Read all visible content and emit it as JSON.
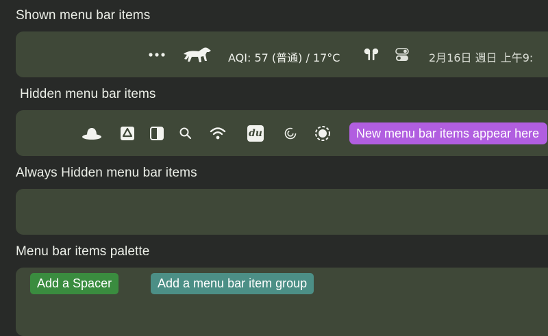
{
  "sections": {
    "shown_title": "Shown menu bar items",
    "hidden_title": "Hidden menu bar items",
    "always_hidden_title": "Always Hidden menu bar items",
    "palette_title": "Menu bar items palette"
  },
  "shown_items": {
    "aqi_text": "AQI: 57 (普通) / 17°C",
    "clock_text": "2月16日 週日  上午9:"
  },
  "hidden_items": {
    "new_items_label": "New menu bar items appear here",
    "du_label": "du"
  },
  "palette": {
    "add_spacer_label": "Add a Spacer",
    "add_group_label": "Add a menu bar item group"
  },
  "icons": [
    "more-icon",
    "dog-icon",
    "airpods-icon",
    "control-center-icon",
    "hat-icon",
    "drive-icon",
    "contrast-icon",
    "search-icon",
    "wifi-icon",
    "du-icon",
    "spiral-icon",
    "dashed-circle-icon"
  ],
  "colors": {
    "background": "#282a28",
    "panel": "#3f4838",
    "new_items_pill": "#b15ee0",
    "spacer_button": "#3a8c3f",
    "group_button": "#4c8f86"
  }
}
